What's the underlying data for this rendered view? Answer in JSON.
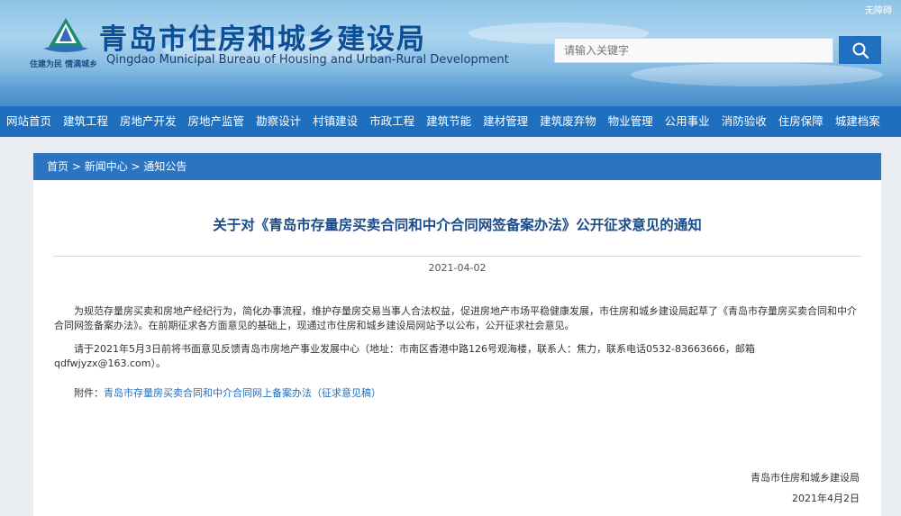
{
  "header": {
    "title_cn": "青岛市住房和城乡建设局",
    "title_en": "Qingdao Municipal Bureau of Housing and Urban-Rural Development",
    "slogan": "住建为民 情满城乡",
    "top_right": "无障碍",
    "search_placeholder": "请输入关键字",
    "search_icon": "search-icon"
  },
  "nav": {
    "items": [
      "网站首页",
      "建筑工程",
      "房地产开发",
      "房地产监管",
      "勘察设计",
      "村镇建设",
      "市政工程",
      "建筑节能",
      "建材管理",
      "建筑废弃物",
      "物业管理",
      "公用事业",
      "消防验收",
      "住房保障",
      "城建档案"
    ]
  },
  "breadcrumb": {
    "home": "首页",
    "section": "新闻中心",
    "current": "通知公告",
    "sep": " > "
  },
  "article": {
    "title": "关于对《青岛市存量房买卖合同和中介合同网签备案办法》公开征求意见的通知",
    "date": "2021-04-02",
    "para1": "为规范存量房买卖和房地产经纪行为，简化办事流程，维护存量房交易当事人合法权益，促进房地产市场平稳健康发展，市住房和城乡建设局起草了《青岛市存量房买卖合同和中介合同网签备案办法》。在前期征求各方面意见的基础上，现通过市住房和城乡建设局网站予以公布，公开征求社会意见。",
    "para2": "请于2021年5月3日前将书面意见反馈青岛市房地产事业发展中心（地址：市南区香港中路126号观海楼，联系人：焦力，联系电话0532-83663666，邮箱qdfwjyzx@163.com）。",
    "attachment_label": "附件：",
    "attachment_link": "青岛市存量房买卖合同和中介合同网上备案办法（征求意见稿）",
    "sign_org": "青岛市住房和城乡建设局",
    "sign_date": "2021年4月2日"
  },
  "colors": {
    "nav_bg": "#1f6fbf",
    "title": "#1a4c8a",
    "header_title": "#0d4f96"
  }
}
